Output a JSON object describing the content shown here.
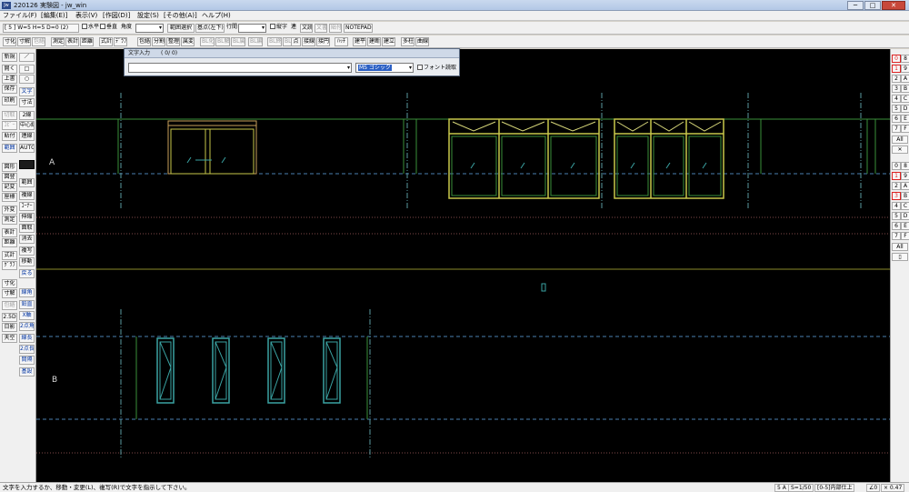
{
  "window": {
    "app_icon_text": "Jw",
    "title": "220126  実験図 - jw_win",
    "buttons": {
      "minimize": "─",
      "maximize": "□",
      "close": "✕"
    }
  },
  "menu": [
    "ファイル(F)",
    "[編集(E)]",
    "表示(V)",
    "[作図(D)]",
    "設定(S)",
    "[その他(A)]",
    "ヘルプ(H)"
  ],
  "toolbar1": {
    "layer_field": "[ 5 ]  W=5  H=5  D=0  (2)",
    "horizontal_label": "水平",
    "vertical_label": "垂直",
    "angle_label": "角度",
    "range_select": "範囲選択",
    "base_point": "基点(左下)",
    "line_spacing_label": "行間",
    "vertical_text_label": "縦字",
    "connect": "連",
    "doc_edit": "文読",
    "doc_save": "文書",
    "paste": "貼付",
    "notepad": "NOTEPAD"
  },
  "toolbar2": [
    "寸化",
    "寸解",
    "包絡",
    "測定",
    "表計",
    "距離",
    "式計",
    "ﾃﾞﾗﾌ",
    "包絡",
    "分割",
    "整理",
    "属変",
    "BL化",
    "BL解",
    "BL属",
    "BL編",
    "BL終",
    "BLﾂﾙ",
    "点",
    "接線",
    "接円",
    "ﾊｯﾁ",
    "建平",
    "建断",
    "建立",
    "多柱",
    "曲線"
  ],
  "left_panel": {
    "col_a": [
      "新規",
      "開く",
      "上書",
      "保存",
      "印刷",
      "切取",
      "ｺﾋﾟｰ",
      "貼付",
      "範囲",
      "",
      "",
      "図形",
      "図登",
      "記変",
      "座標",
      "外変",
      "測定",
      "表計",
      "距離",
      "式計",
      "ｸﾞﾗﾌ",
      "",
      "寸化",
      "寸解",
      "包絡",
      "2.5D",
      "日影",
      "天空"
    ],
    "col_b": [
      "／",
      "□",
      "○",
      "文字",
      "寸法",
      "2線",
      "中心線",
      "連線",
      "AUTO",
      "",
      "範囲",
      "複線",
      "ｺｰﾅｰ",
      "伸縮",
      "面取",
      "消去",
      "複写",
      "移動",
      "戻る",
      "",
      "線角",
      "鉛直",
      "X軸",
      "2点角",
      "線長",
      "2点長",
      "間隔",
      "基設"
    ]
  },
  "right_panel": {
    "layers": [
      "0",
      "1",
      "2",
      "3",
      "4",
      "5",
      "6",
      "7",
      "8",
      "9",
      "A",
      "B",
      "C",
      "D",
      "E",
      "F"
    ],
    "layer_all": "All",
    "groups": [
      "0",
      "8",
      "1",
      "9",
      "2",
      "A",
      "3",
      "B",
      "4",
      "C",
      "5",
      "D",
      "6",
      "E",
      "7",
      "F"
    ],
    "group_all": "All"
  },
  "dialog": {
    "title": "文字入力",
    "counter": "( 0/  0)",
    "input_value": "",
    "font_value": "MS ゴシック",
    "font_checkbox_label": "フォント読取"
  },
  "drawing": {
    "label_a": "A",
    "label_b": "B",
    "cursor_label": "0"
  },
  "status": {
    "message": "文字を入力するか、移動・変更(L)、複写(R)で文字を指示して下さい。",
    "layer": "5 A",
    "scale": "S=1/50",
    "layer_name": "[0-5]内部仕上",
    "angle": "∠0",
    "zoom": "× 0.47"
  },
  "colors": {
    "canvas": "#000000",
    "green_line": "#3a8f3a",
    "yellow_frame": "#c7c74a",
    "cyan_frame": "#3aa3a3",
    "dash_line": "#5a9aa0"
  }
}
